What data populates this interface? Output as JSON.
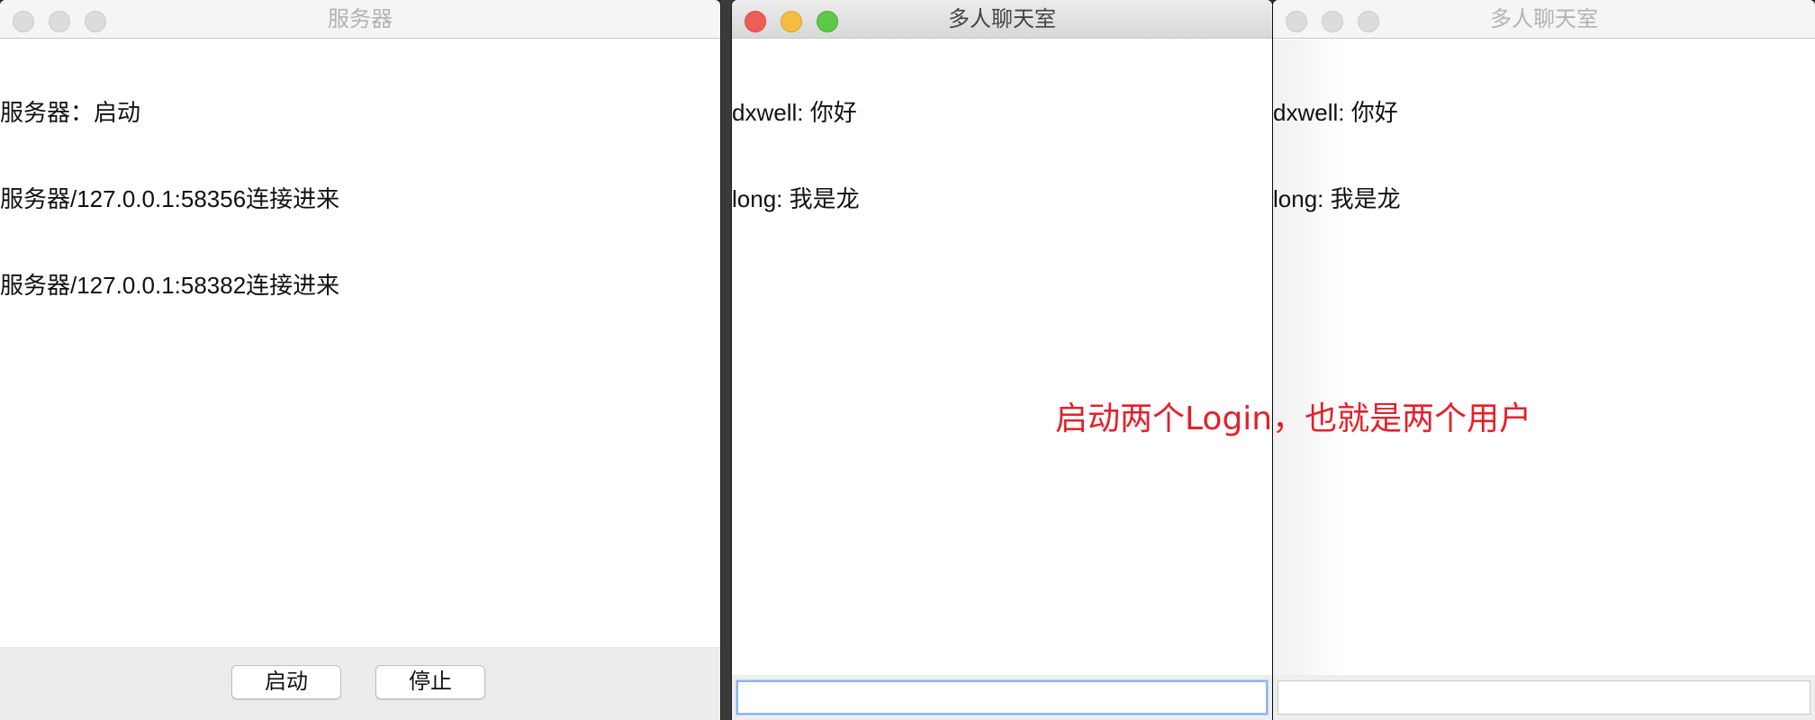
{
  "server_window": {
    "title": "服务器",
    "log_lines": [
      "服务器：启动",
      "服务器/127.0.0.1:58356连接进来",
      "服务器/127.0.0.1:58382连接进来"
    ],
    "start_button": "启动",
    "stop_button": "停止"
  },
  "chat_window_1": {
    "title": "多人聊天室",
    "messages": [
      "dxwell: 你好",
      "long: 我是龙"
    ],
    "input_value": ""
  },
  "chat_window_2": {
    "title": "多人聊天室",
    "messages": [
      "dxwell: 你好",
      "long: 我是龙"
    ],
    "input_value": ""
  },
  "annotation": "启动两个Login，也就是两个用户",
  "colors": {
    "annotation": "#e4202a",
    "close_light": "#ef5d57",
    "minimize_light": "#f4bd3f",
    "maximize_light": "#5ec84b",
    "input_focus": "#8db5ee"
  }
}
